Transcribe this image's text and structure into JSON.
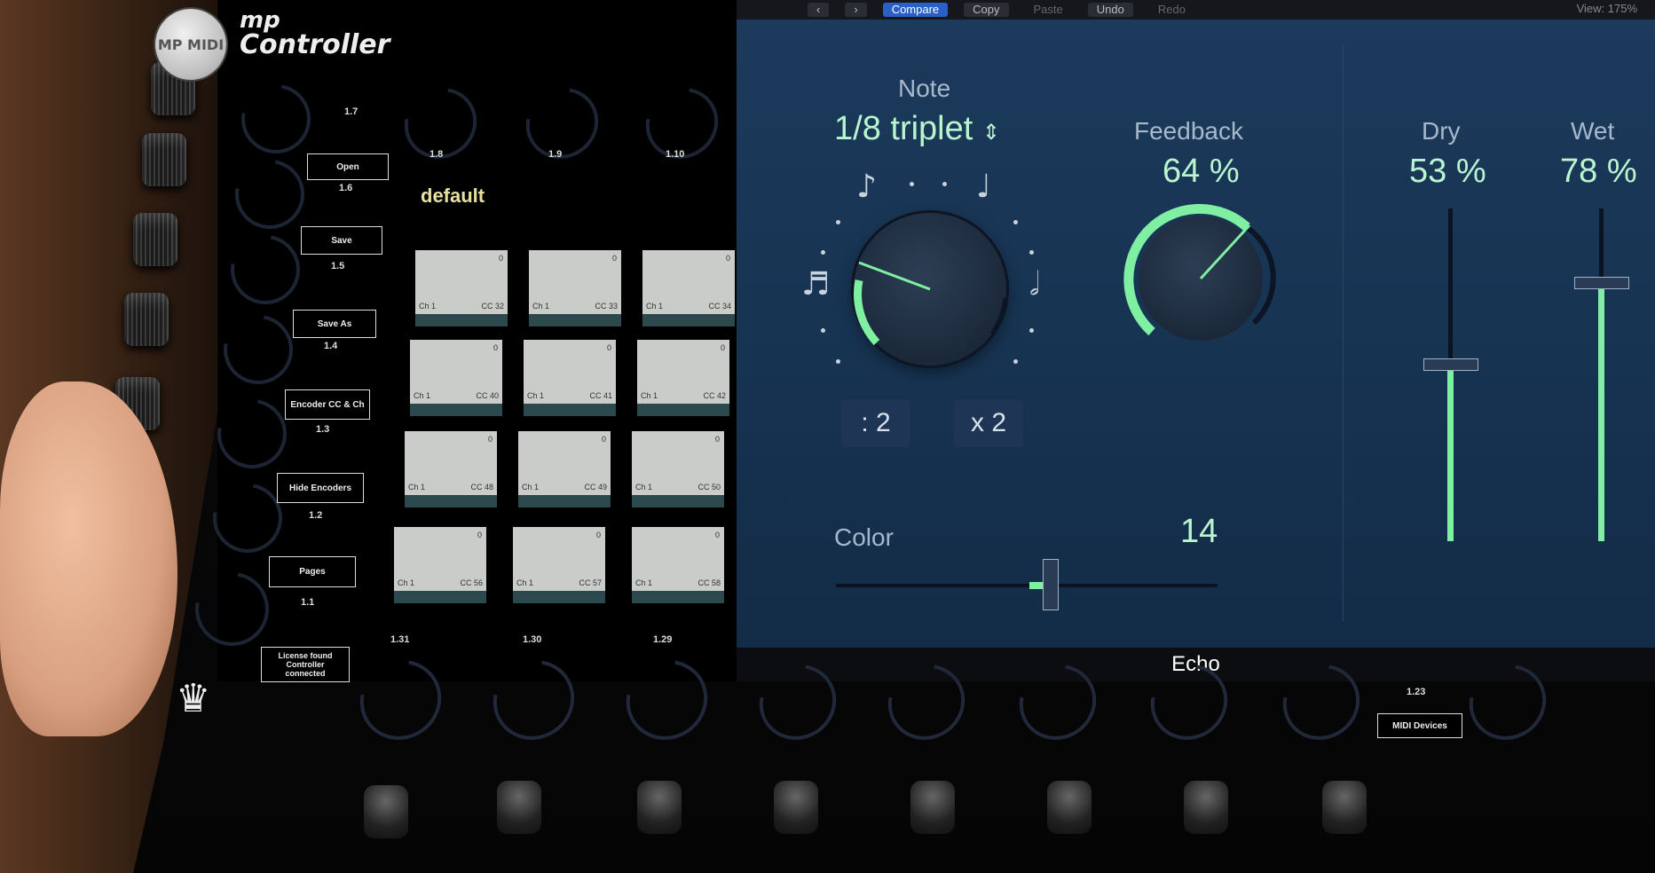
{
  "controller": {
    "brand_line1": "mp",
    "brand_line2": "Controller",
    "logo_text": "MP MIDI",
    "preset_name": "default",
    "top_encoder_labels": [
      "1.7",
      "1.8",
      "1.9",
      "1.10"
    ],
    "menu": [
      {
        "label": "Open",
        "id": "1.6"
      },
      {
        "label": "Save",
        "id": "1.5"
      },
      {
        "label": "Save As",
        "id": "1.4"
      },
      {
        "label": "Encoder CC & Ch",
        "id": "1.3"
      },
      {
        "label": "Hide Encoders",
        "id": "1.2"
      },
      {
        "label": "Pages",
        "id": "1.1"
      }
    ],
    "license_line1": "License found",
    "license_line2": "Controller",
    "license_line3": "connected",
    "bottom_encoder_labels": [
      "1.31",
      "1.30",
      "1.29"
    ],
    "right_encoder_label": "1.23",
    "midi_devices_label": "MIDI Devices",
    "pads": [
      {
        "value": "0",
        "ch": "Ch 1",
        "cc": "CC 32"
      },
      {
        "value": "0",
        "ch": "Ch 1",
        "cc": "CC 33"
      },
      {
        "value": "0",
        "ch": "Ch 1",
        "cc": "CC 34"
      },
      {
        "value": "0",
        "ch": "Ch 1",
        "cc": "CC 40"
      },
      {
        "value": "0",
        "ch": "Ch 1",
        "cc": "CC 41"
      },
      {
        "value": "0",
        "ch": "Ch 1",
        "cc": "CC 42"
      },
      {
        "value": "0",
        "ch": "Ch 1",
        "cc": "CC 48"
      },
      {
        "value": "0",
        "ch": "Ch 1",
        "cc": "CC 49"
      },
      {
        "value": "0",
        "ch": "Ch 1",
        "cc": "CC 50"
      },
      {
        "value": "0",
        "ch": "Ch 1",
        "cc": "CC 56"
      },
      {
        "value": "0",
        "ch": "Ch 1",
        "cc": "CC 57"
      },
      {
        "value": "0",
        "ch": "Ch 1",
        "cc": "CC 58"
      }
    ]
  },
  "plugin": {
    "toolbar": {
      "prev_icon": "chevron-left-icon",
      "next_icon": "chevron-right-icon",
      "compare": "Compare",
      "copy": "Copy",
      "paste": "Paste",
      "undo": "Undo",
      "redo": "Redo",
      "view_label": "View:",
      "view_value": "175%"
    },
    "note_label": "Note",
    "note_value": "1/8 triplet",
    "feedback_label": "Feedback",
    "feedback_value": "64 %",
    "feedback_level": 0.64,
    "dry_label": "Dry",
    "dry_value": "53 %",
    "dry_level": 0.53,
    "wet_label": "Wet",
    "wet_value": "78 %",
    "wet_level": 0.78,
    "divide_button": ": 2",
    "multiply_button": "x 2",
    "color_label": "Color",
    "color_value": "14",
    "title": "Echo",
    "accent_color": "#7ff0a2"
  }
}
